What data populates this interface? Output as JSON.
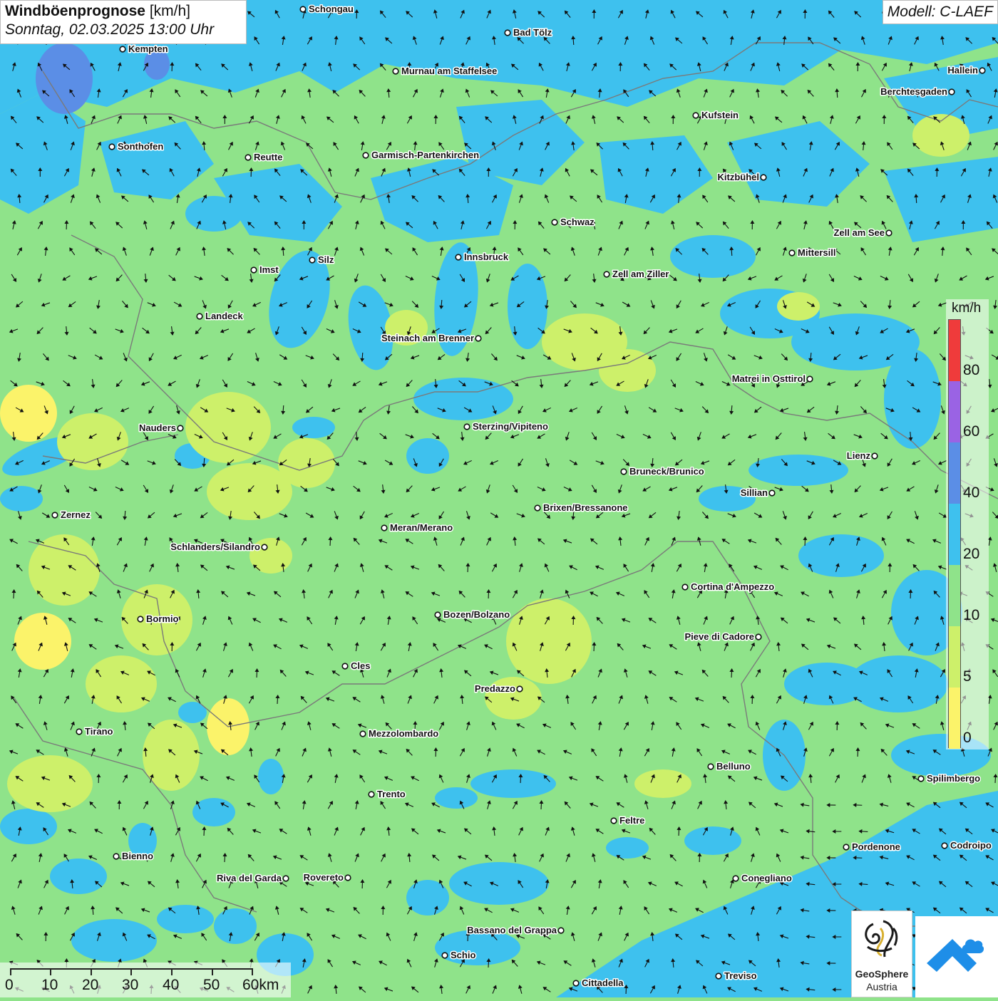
{
  "header": {
    "title_bold": "Windböenprognose",
    "title_unit": "[km/h]",
    "datetime": "Sonntag, 02.03.2025 13:00 Uhr",
    "model": "Modell: C-LAEF"
  },
  "legend": {
    "unit": "km/h",
    "labels": [
      "80",
      "60",
      "40",
      "20",
      "10",
      "5",
      "0"
    ],
    "colors": {
      "0-5": "#fbf36a",
      "5-10": "#cdf06a",
      "10-20": "#8fe38a",
      "20-40": "#3ec1ee",
      "40-60": "#5b8ee6",
      "60-80": "#9a63e4",
      "80+": "#ef3b3b"
    }
  },
  "scalebar": {
    "labels": [
      "0",
      "10",
      "20",
      "30",
      "40",
      "50",
      "60km"
    ]
  },
  "logos": {
    "geosphere_line1": "GeoSphere",
    "geosphere_line2": "Austria"
  },
  "cities": [
    {
      "name": "Schongau"
    },
    {
      "name": "Bad Tölz"
    },
    {
      "name": "Kempten"
    },
    {
      "name": "Murnau am Staffelsee"
    },
    {
      "name": "Hallein"
    },
    {
      "name": "Berchtesgaden"
    },
    {
      "name": "Kufstein"
    },
    {
      "name": "Sonthofen"
    },
    {
      "name": "Reutte"
    },
    {
      "name": "Garmisch-Partenkirchen"
    },
    {
      "name": "Kitzbühel"
    },
    {
      "name": "Schwaz"
    },
    {
      "name": "Zell am See"
    },
    {
      "name": "Mittersill"
    },
    {
      "name": "Innsbruck"
    },
    {
      "name": "Silz"
    },
    {
      "name": "Imst"
    },
    {
      "name": "Zell am Ziller"
    },
    {
      "name": "Landeck"
    },
    {
      "name": "Steinach am Brenner"
    },
    {
      "name": "Matrei in Osttirol"
    },
    {
      "name": "Nauders"
    },
    {
      "name": "Sterzing/Vipiteno"
    },
    {
      "name": "Lienz"
    },
    {
      "name": "Bruneck/Brunico"
    },
    {
      "name": "Sillian"
    },
    {
      "name": "Brixen/Bressanone"
    },
    {
      "name": "Zernez"
    },
    {
      "name": "Meran/Merano"
    },
    {
      "name": "Schlanders/Silandro"
    },
    {
      "name": "Cortina d'Ampezzo"
    },
    {
      "name": "Bozen/Bolzano"
    },
    {
      "name": "Bormio"
    },
    {
      "name": "Pieve di Cadore"
    },
    {
      "name": "Cles"
    },
    {
      "name": "Predazzo"
    },
    {
      "name": "Tirano"
    },
    {
      "name": "Mezzolombardo"
    },
    {
      "name": "Belluno"
    },
    {
      "name": "Spilimbergo"
    },
    {
      "name": "Trento"
    },
    {
      "name": "Feltre"
    },
    {
      "name": "Pordenone"
    },
    {
      "name": "Codroipo"
    },
    {
      "name": "Bienno"
    },
    {
      "name": "Riva del Garda"
    },
    {
      "name": "Rovereto"
    },
    {
      "name": "Conegliano"
    },
    {
      "name": "Bassano del Grappa"
    },
    {
      "name": "Schio"
    },
    {
      "name": "Treviso"
    },
    {
      "name": "Cittadella"
    }
  ]
}
